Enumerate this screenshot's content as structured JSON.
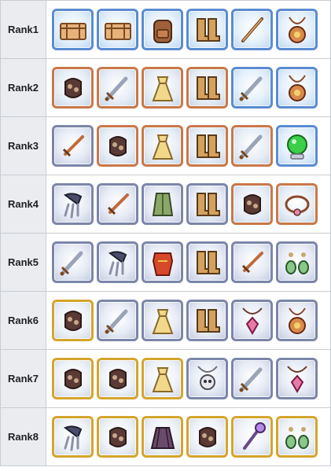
{
  "colors": {
    "blue": "#5b8bd1",
    "copper": "#c9784a",
    "silver": "#7b86a8",
    "gold": "#d4a52c"
  },
  "rows": [
    {
      "label": "Rank1",
      "items": [
        {
          "icon": "crate-icon",
          "tier": "blue"
        },
        {
          "icon": "crate-icon",
          "tier": "blue"
        },
        {
          "icon": "backpack-icon",
          "tier": "blue"
        },
        {
          "icon": "boots-icon",
          "tier": "blue"
        },
        {
          "icon": "wand-icon",
          "tier": "blue"
        },
        {
          "icon": "amulet-icon",
          "tier": "blue"
        }
      ]
    },
    {
      "label": "Rank2",
      "items": [
        {
          "icon": "gauntlet-icon",
          "tier": "copper"
        },
        {
          "icon": "sword-icon",
          "tier": "copper"
        },
        {
          "icon": "dress-icon",
          "tier": "copper"
        },
        {
          "icon": "boots-icon",
          "tier": "copper"
        },
        {
          "icon": "sword-icon",
          "tier": "blue"
        },
        {
          "icon": "amulet-icon",
          "tier": "blue"
        }
      ]
    },
    {
      "label": "Rank3",
      "items": [
        {
          "icon": "dagger-icon",
          "tier": "silver"
        },
        {
          "icon": "gauntlet-icon",
          "tier": "copper"
        },
        {
          "icon": "dress-icon",
          "tier": "copper"
        },
        {
          "icon": "boots-icon",
          "tier": "copper"
        },
        {
          "icon": "sword-icon",
          "tier": "copper"
        },
        {
          "icon": "crystal-ball-icon",
          "tier": "blue"
        }
      ]
    },
    {
      "label": "Rank4",
      "items": [
        {
          "icon": "claw-icon",
          "tier": "silver"
        },
        {
          "icon": "dagger-icon",
          "tier": "silver"
        },
        {
          "icon": "robe-icon",
          "tier": "silver"
        },
        {
          "icon": "boots-icon",
          "tier": "silver"
        },
        {
          "icon": "gauntlet-icon",
          "tier": "copper"
        },
        {
          "icon": "bracelet-icon",
          "tier": "copper"
        }
      ]
    },
    {
      "label": "Rank5",
      "items": [
        {
          "icon": "sword-icon",
          "tier": "silver"
        },
        {
          "icon": "claw-icon",
          "tier": "silver"
        },
        {
          "icon": "armor-icon",
          "tier": "silver"
        },
        {
          "icon": "boots-icon",
          "tier": "silver"
        },
        {
          "icon": "dagger-icon",
          "tier": "silver"
        },
        {
          "icon": "earrings-icon",
          "tier": "silver"
        }
      ]
    },
    {
      "label": "Rank6",
      "items": [
        {
          "icon": "gauntlet-icon",
          "tier": "gold"
        },
        {
          "icon": "sword-icon",
          "tier": "silver"
        },
        {
          "icon": "dress-icon",
          "tier": "silver"
        },
        {
          "icon": "boots-icon",
          "tier": "silver"
        },
        {
          "icon": "pendant-icon",
          "tier": "silver"
        },
        {
          "icon": "amulet-icon",
          "tier": "silver"
        }
      ]
    },
    {
      "label": "Rank7",
      "items": [
        {
          "icon": "gauntlet-icon",
          "tier": "gold"
        },
        {
          "icon": "gauntlet-icon",
          "tier": "gold"
        },
        {
          "icon": "dress-icon",
          "tier": "gold"
        },
        {
          "icon": "skull-pendant-icon",
          "tier": "silver"
        },
        {
          "icon": "sword-icon",
          "tier": "silver"
        },
        {
          "icon": "pendant-icon",
          "tier": "silver"
        }
      ]
    },
    {
      "label": "Rank8",
      "items": [
        {
          "icon": "claw-icon",
          "tier": "gold"
        },
        {
          "icon": "gauntlet-icon",
          "tier": "gold"
        },
        {
          "icon": "skirt-icon",
          "tier": "gold"
        },
        {
          "icon": "gauntlet-icon",
          "tier": "gold"
        },
        {
          "icon": "staff-icon",
          "tier": "gold"
        },
        {
          "icon": "earrings-icon",
          "tier": "gold"
        }
      ]
    }
  ]
}
